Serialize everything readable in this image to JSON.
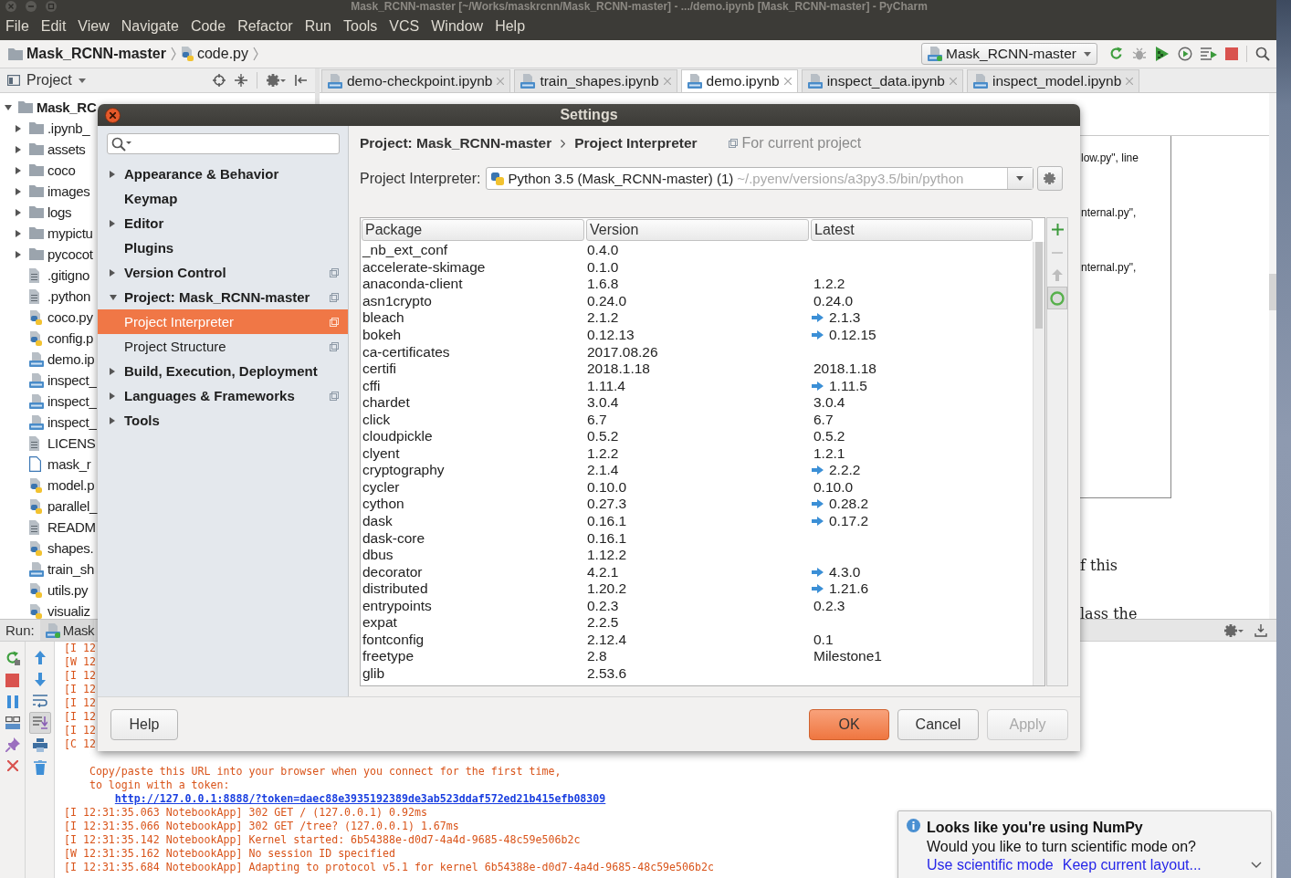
{
  "window": {
    "title": "Mask_RCNN-master [~/Works/maskrcnn/Mask_RCNN-master] - .../demo.ipynb [Mask_RCNN-master] - PyCharm"
  },
  "menu": [
    "File",
    "Edit",
    "View",
    "Navigate",
    "Code",
    "Refactor",
    "Run",
    "Tools",
    "VCS",
    "Window",
    "Help"
  ],
  "navigation_bar": {
    "breadcrumbs": [
      {
        "label": "Mask_RCNN-master",
        "kind": "folder"
      },
      {
        "label": "code.py",
        "kind": "python"
      }
    ],
    "run_configuration": "Mask_RCNN-master"
  },
  "project_panel": {
    "title": "Project",
    "tree": [
      {
        "label": "Mask_RC",
        "kind": "folder",
        "expanded": true,
        "children": [
          {
            "label": ".ipynb_",
            "kind": "folder",
            "expanded": false
          },
          {
            "label": "assets",
            "kind": "folder",
            "expanded": false
          },
          {
            "label": "coco",
            "kind": "folder",
            "expanded": false
          },
          {
            "label": "images",
            "kind": "folder",
            "expanded": false
          },
          {
            "label": "logs",
            "kind": "folder",
            "expanded": false
          },
          {
            "label": "mypictu",
            "kind": "folder",
            "expanded": false
          },
          {
            "label": "pycocot",
            "kind": "folder",
            "expanded": false
          },
          {
            "label": ".gitigno",
            "kind": "text"
          },
          {
            "label": ".python",
            "kind": "text"
          },
          {
            "label": "coco.py",
            "kind": "python"
          },
          {
            "label": "config.p",
            "kind": "python"
          },
          {
            "label": "demo.ip",
            "kind": "notebook"
          },
          {
            "label": "inspect_",
            "kind": "notebook"
          },
          {
            "label": "inspect_",
            "kind": "notebook"
          },
          {
            "label": "inspect_",
            "kind": "notebook"
          },
          {
            "label": "LICENS",
            "kind": "text"
          },
          {
            "label": "mask_r",
            "kind": "file"
          },
          {
            "label": "model.p",
            "kind": "python"
          },
          {
            "label": "parallel_",
            "kind": "python"
          },
          {
            "label": "READM",
            "kind": "text"
          },
          {
            "label": "shapes.",
            "kind": "python"
          },
          {
            "label": "train_sh",
            "kind": "notebook"
          },
          {
            "label": "utils.py",
            "kind": "python"
          },
          {
            "label": "visualiz",
            "kind": "python"
          }
        ]
      }
    ]
  },
  "editor": {
    "tabs": [
      {
        "label": "demo-checkpoint.ipynb",
        "selected": false
      },
      {
        "label": "train_shapes.ipynb",
        "selected": false
      },
      {
        "label": "demo.ipynb",
        "selected": true
      },
      {
        "label": "inspect_data.ipynb",
        "selected": false
      },
      {
        "label": "inspect_model.ipynb",
        "selected": false
      }
    ],
    "output_lines": [
      "low.py\", line",
      "nternal.py\",",
      "nternal.py\","
    ],
    "text_lines": [
      "f this",
      "lass the"
    ]
  },
  "run_panel": {
    "label": "Run:",
    "tab": "Mask",
    "lines_before": [
      "[I 12",
      "[W 12",
      "[I 12",
      "[I 12",
      "[I 12",
      "[I 12",
      "[I 12",
      "[C 12"
    ],
    "message": [
      "Copy/paste this URL into your browser when you connect for the first time,",
      "to login with a token:"
    ],
    "url": "http://127.0.0.1:8888/?token=daec88e3935192389de3ab523ddaf572ed21b415efb08309",
    "lines_after": [
      "[I 12:31:35.063 NotebookApp] 302 GET / (127.0.0.1) 0.92ms",
      "[I 12:31:35.066 NotebookApp] 302 GET /tree? (127.0.0.1) 1.67ms",
      "[I 12:31:35.142 NotebookApp] Kernel started: 6b54388e-d0d7-4a4d-9685-48c59e506b2c",
      "[W 12:31:35.162 NotebookApp] No session ID specified",
      "[I 12:31:35.684 NotebookApp] Adapting to protocol v5.1 for kernel 6b54388e-d0d7-4a4d-9685-48c59e506b2c"
    ]
  },
  "settings_dialog": {
    "title": "Settings",
    "tree": [
      {
        "label": "Appearance & Behavior",
        "expanded": false,
        "project_scope": false,
        "selected": false
      },
      {
        "label": "Keymap",
        "project_scope": false,
        "selected": false
      },
      {
        "label": "Editor",
        "expanded": false,
        "project_scope": false,
        "selected": false
      },
      {
        "label": "Plugins",
        "project_scope": false,
        "selected": false
      },
      {
        "label": "Version Control",
        "expanded": false,
        "project_scope": true,
        "selected": false
      },
      {
        "label": "Project: Mask_RCNN-master",
        "expanded": true,
        "project_scope": true,
        "selected": false,
        "children": [
          {
            "label": "Project Interpreter",
            "project_scope": true,
            "selected": true
          },
          {
            "label": "Project Structure",
            "project_scope": true,
            "selected": false
          }
        ]
      },
      {
        "label": "Build, Execution, Deployment",
        "expanded": false,
        "project_scope": false,
        "selected": false
      },
      {
        "label": "Languages & Frameworks",
        "expanded": false,
        "project_scope": true,
        "selected": false
      },
      {
        "label": "Tools",
        "expanded": false,
        "project_scope": false,
        "selected": false
      }
    ],
    "breadcrumb": [
      "Project: Mask_RCNN-master",
      "Project Interpreter"
    ],
    "scope_note": "For current project",
    "interpreter": {
      "label": "Project Interpreter:",
      "name": "Python 3.5 (Mask_RCNN-master) (1)",
      "path": "~/.pyenv/versions/a3py3.5/bin/python"
    },
    "packages": {
      "columns": [
        "Package",
        "Version",
        "Latest"
      ],
      "rows": [
        {
          "package": "_nb_ext_conf",
          "version": "0.4.0",
          "upgrade": false
        },
        {
          "package": "accelerate-skimage",
          "version": "0.1.0",
          "upgrade": false
        },
        {
          "package": "anaconda-client",
          "version": "1.6.8",
          "latest": "1.2.2",
          "upgrade": false
        },
        {
          "package": "asn1crypto",
          "version": "0.24.0",
          "latest": "0.24.0",
          "upgrade": false
        },
        {
          "package": "bleach",
          "version": "2.1.2",
          "latest": "2.1.3",
          "upgrade": true
        },
        {
          "package": "bokeh",
          "version": "0.12.13",
          "latest": "0.12.15",
          "upgrade": true
        },
        {
          "package": "ca-certificates",
          "version": "2017.08.26",
          "upgrade": false
        },
        {
          "package": "certifi",
          "version": "2018.1.18",
          "latest": "2018.1.18",
          "upgrade": false
        },
        {
          "package": "cffi",
          "version": "1.11.4",
          "latest": "1.11.5",
          "upgrade": true
        },
        {
          "package": "chardet",
          "version": "3.0.4",
          "latest": "3.0.4",
          "upgrade": false
        },
        {
          "package": "click",
          "version": "6.7",
          "latest": "6.7",
          "upgrade": false
        },
        {
          "package": "cloudpickle",
          "version": "0.5.2",
          "latest": "0.5.2",
          "upgrade": false
        },
        {
          "package": "clyent",
          "version": "1.2.2",
          "latest": "1.2.1",
          "upgrade": false
        },
        {
          "package": "cryptography",
          "version": "2.1.4",
          "latest": "2.2.2",
          "upgrade": true
        },
        {
          "package": "cycler",
          "version": "0.10.0",
          "latest": "0.10.0",
          "upgrade": false
        },
        {
          "package": "cython",
          "version": "0.27.3",
          "latest": "0.28.2",
          "upgrade": true
        },
        {
          "package": "dask",
          "version": "0.16.1",
          "latest": "0.17.2",
          "upgrade": true
        },
        {
          "package": "dask-core",
          "version": "0.16.1",
          "upgrade": false
        },
        {
          "package": "dbus",
          "version": "1.12.2",
          "upgrade": false
        },
        {
          "package": "decorator",
          "version": "4.2.1",
          "latest": "4.3.0",
          "upgrade": true
        },
        {
          "package": "distributed",
          "version": "1.20.2",
          "latest": "1.21.6",
          "upgrade": true
        },
        {
          "package": "entrypoints",
          "version": "0.2.3",
          "latest": "0.2.3",
          "upgrade": false
        },
        {
          "package": "expat",
          "version": "2.2.5",
          "upgrade": false
        },
        {
          "package": "fontconfig",
          "version": "2.12.4",
          "latest": "0.1",
          "upgrade": false
        },
        {
          "package": "freetype",
          "version": "2.8",
          "latest": "Milestone1",
          "upgrade": false
        },
        {
          "package": "glib",
          "version": "2.53.6",
          "upgrade": false
        }
      ]
    },
    "package_actions": [
      {
        "kind": "add",
        "disabled": false
      },
      {
        "kind": "remove",
        "disabled": true
      },
      {
        "kind": "upgrade",
        "disabled": true
      },
      {
        "kind": "toggle",
        "disabled": false
      }
    ],
    "help": "Help",
    "buttons": [
      {
        "label": "OK",
        "kind": "primary",
        "disabled": false
      },
      {
        "label": "Cancel",
        "kind": "normal",
        "disabled": false
      },
      {
        "label": "Apply",
        "kind": "normal",
        "disabled": true
      }
    ]
  },
  "notification": {
    "title": "Looks like you're using NumPy",
    "message": "Would you like to turn scientific mode on?",
    "actions": [
      "Use scientific mode",
      "Keep current layout..."
    ]
  }
}
